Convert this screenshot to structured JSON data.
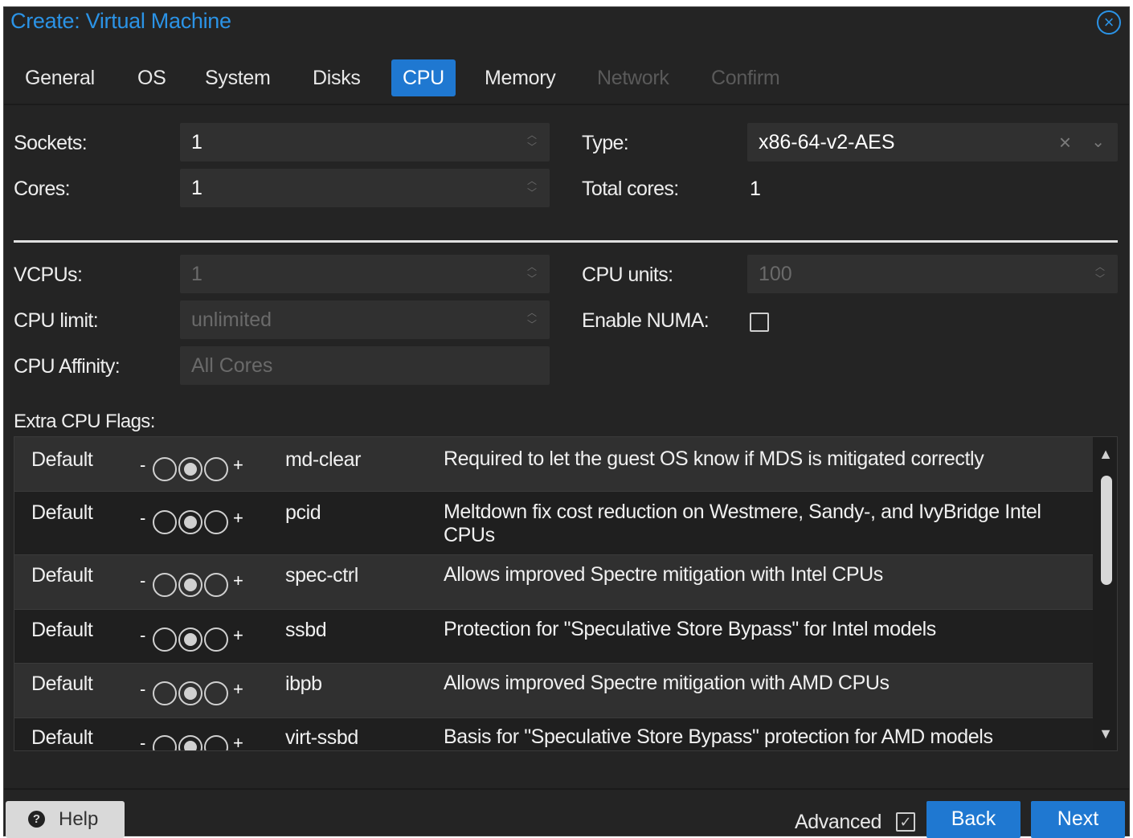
{
  "window": {
    "title": "Create: Virtual Machine"
  },
  "tabs": [
    {
      "label": "General",
      "state": "normal"
    },
    {
      "label": "OS",
      "state": "normal"
    },
    {
      "label": "System",
      "state": "normal"
    },
    {
      "label": "Disks",
      "state": "normal"
    },
    {
      "label": "CPU",
      "state": "active"
    },
    {
      "label": "Memory",
      "state": "normal"
    },
    {
      "label": "Network",
      "state": "disabled"
    },
    {
      "label": "Confirm",
      "state": "disabled"
    }
  ],
  "cpu": {
    "sockets_label": "Sockets:",
    "sockets_value": "1",
    "cores_label": "Cores:",
    "cores_value": "1",
    "type_label": "Type:",
    "type_value": "x86-64-v2-AES",
    "total_cores_label": "Total cores:",
    "total_cores_value": "1",
    "vcpus_label": "VCPUs:",
    "vcpus_value": "1",
    "cpu_limit_label": "CPU limit:",
    "cpu_limit_value": "unlimited",
    "cpu_affinity_label": "CPU Affinity:",
    "cpu_affinity_placeholder": "All Cores",
    "cpu_units_label": "CPU units:",
    "cpu_units_value": "100",
    "numa_label": "Enable NUMA:",
    "numa_checked": false
  },
  "flags": {
    "label": "Extra CPU Flags:",
    "rows": [
      {
        "state": "Default",
        "name": "md-clear",
        "description": "Required to let the guest OS know if MDS is mitigated correctly"
      },
      {
        "state": "Default",
        "name": "pcid",
        "description": "Meltdown fix cost reduction on Westmere, Sandy-, and IvyBridge Intel CPUs"
      },
      {
        "state": "Default",
        "name": "spec-ctrl",
        "description": "Allows improved Spectre mitigation with Intel CPUs"
      },
      {
        "state": "Default",
        "name": "ssbd",
        "description": "Protection for \"Speculative Store Bypass\" for Intel models"
      },
      {
        "state": "Default",
        "name": "ibpb",
        "description": "Allows improved Spectre mitigation with AMD CPUs"
      },
      {
        "state": "Default",
        "name": "virt-ssbd",
        "description": "Basis for \"Speculative Store Bypass\" protection for AMD models"
      }
    ],
    "minus": "-",
    "plus": "+"
  },
  "footer": {
    "help_label": "Help",
    "advanced_label": "Advanced",
    "advanced_checked": true,
    "back_label": "Back",
    "next_label": "Next"
  },
  "colors": {
    "accent": "#1f78d1",
    "title": "#2b93e6",
    "background": "#242424"
  },
  "icons": {
    "close": "close-circle-icon",
    "help": "question-circle-icon",
    "spinner": "up-down-spinner-icon",
    "clear": "clear-x-icon",
    "dropdown": "chevron-down-icon"
  }
}
